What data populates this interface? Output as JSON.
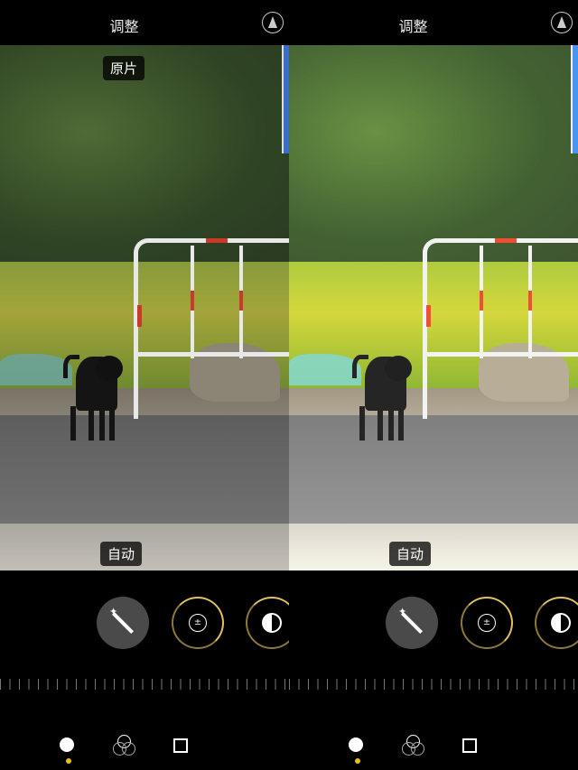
{
  "panels": [
    {
      "header": {
        "title": "调整",
        "auto_icon": "auto-enhance-a-icon"
      },
      "photo_badge": "原片",
      "auto_label": "自动"
    },
    {
      "header": {
        "title": "调整",
        "auto_icon": "auto-enhance-a-icon"
      },
      "photo_badge": "",
      "auto_label": "自动"
    }
  ],
  "tools": [
    "magic-wand-icon",
    "exposure-icon",
    "brilliance-icon"
  ],
  "tabs": [
    "adjust-dial-icon",
    "filters-icon",
    "crop-rotate-icon"
  ],
  "colors": {
    "accent": "#e6be2c",
    "background": "#000000"
  }
}
